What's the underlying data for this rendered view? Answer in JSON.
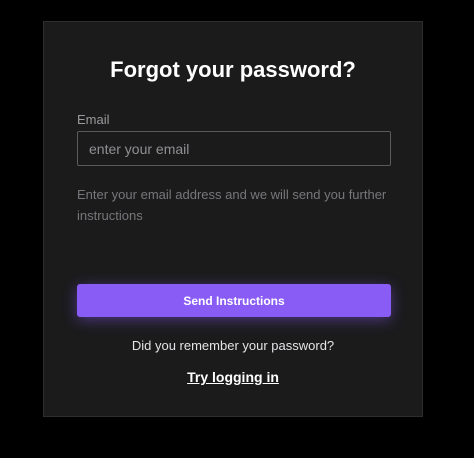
{
  "form": {
    "title": "Forgot your password?",
    "email_label": "Email",
    "email_placeholder": "enter your email",
    "email_value": "",
    "help_text": "Enter your email address and we will send you further instructions",
    "send_button_label": "Send Instructions",
    "remember_text": "Did you remember your password?",
    "login_link_label": "Try logging in"
  },
  "colors": {
    "background": "#000000",
    "card": "#1b1b1c",
    "accent": "#8a5cf6",
    "text_primary": "#ffffff",
    "text_muted": "#77777b"
  }
}
